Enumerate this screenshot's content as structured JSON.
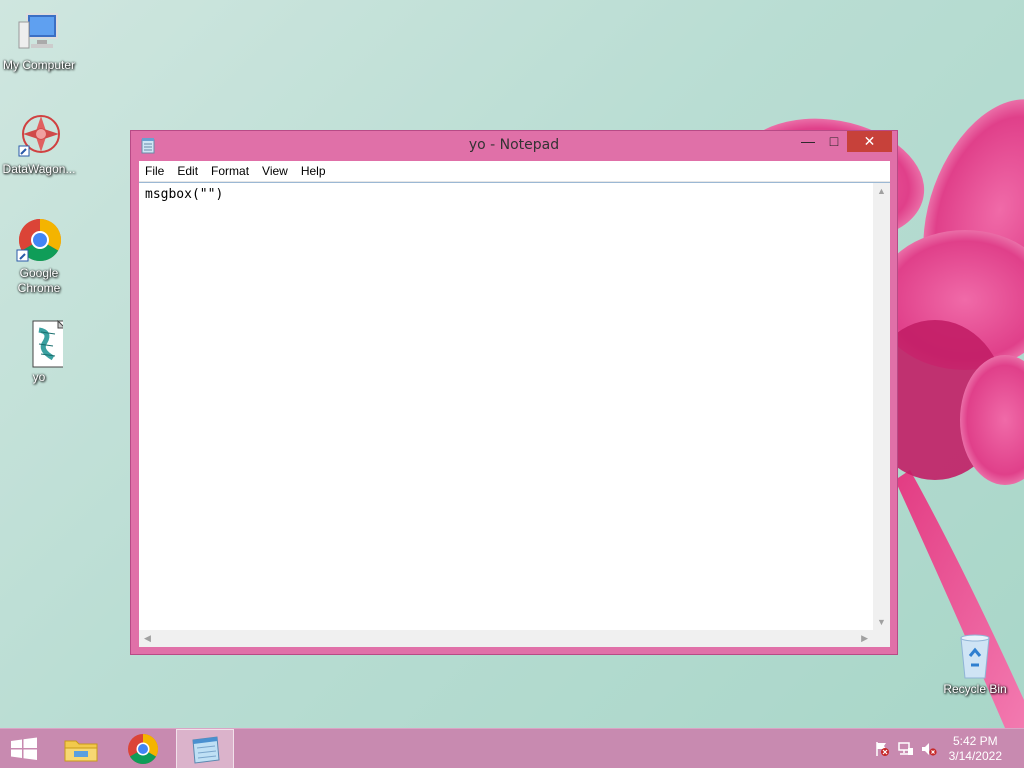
{
  "desktop": {
    "icons": [
      {
        "label": "My Computer",
        "icon": "computer-icon"
      },
      {
        "label": "DataWagon...",
        "icon": "datawagon-icon"
      },
      {
        "label": "Google Chrome",
        "icon": "chrome-icon"
      },
      {
        "label": "yo",
        "icon": "vbs-script-icon"
      },
      {
        "label": "Recycle Bin",
        "icon": "recycle-bin-icon"
      }
    ]
  },
  "window": {
    "title": "yo - Notepad",
    "controls": {
      "minimize": "—",
      "maximize": "□",
      "close": "✕"
    },
    "menu": [
      "File",
      "Edit",
      "Format",
      "View",
      "Help"
    ],
    "content": "msgbox(\"\")"
  },
  "taskbar": {
    "items": [
      "start-icon",
      "file-explorer-icon",
      "chrome-icon",
      "notepad-icon"
    ],
    "active_item": "notepad-icon",
    "clock": {
      "time": "5:42 PM",
      "date": "3/14/2022"
    },
    "tray": [
      "action-center-flag-icon",
      "network-icon",
      "volume-muted-icon"
    ]
  },
  "colors": {
    "accent": "#e070a8",
    "taskbar": "#c88ab0",
    "close": "#c7413a"
  }
}
